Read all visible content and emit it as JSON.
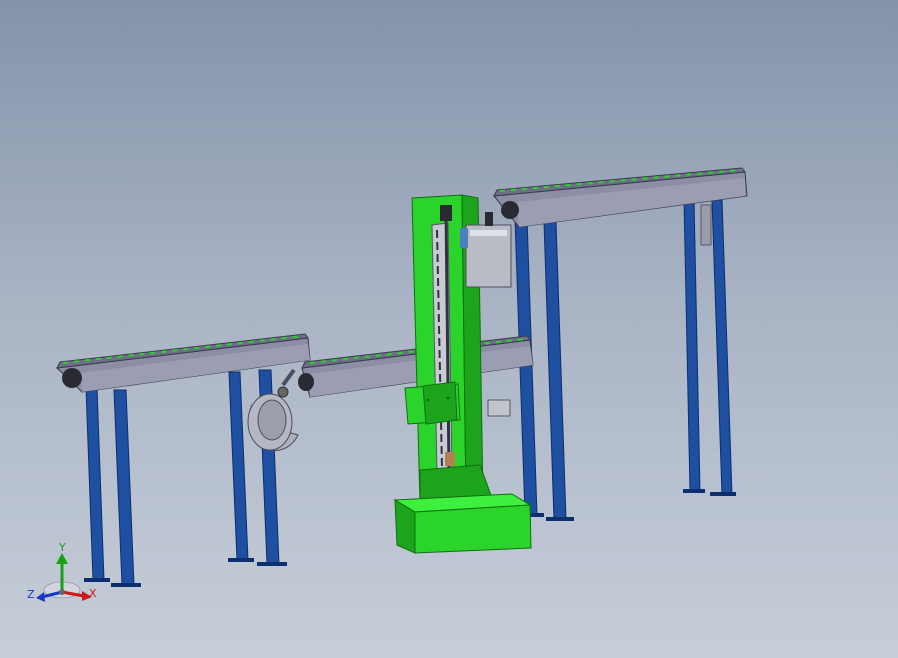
{
  "viewport": {
    "colors": {
      "background_top": "#8592a9",
      "background_bottom": "#c7ced9",
      "frame": "#1f4fa0",
      "frame_dark": "#0c2f6f",
      "rail": "#8c8ea6",
      "rail_dark": "#55566c",
      "machine": "#2bd42b",
      "machine_dark": "#138a13",
      "motor": "#b9bcc4"
    }
  },
  "triad": {
    "x_label": "X",
    "y_label": "Y",
    "z_label": "Z",
    "x_color": "#d01818",
    "y_color": "#18a018",
    "z_color": "#1838c8"
  }
}
